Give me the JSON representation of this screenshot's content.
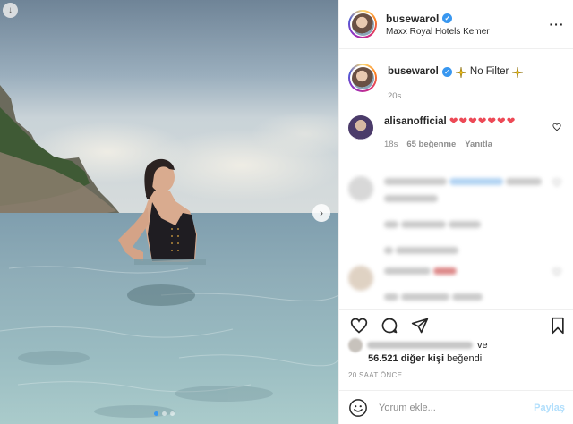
{
  "header": {
    "username": "busewarol",
    "location": "Maxx Royal Hotels Kemer",
    "more_icon": "more-horizontal-icon"
  },
  "caption": {
    "username": "busewarol",
    "text": "No Filter",
    "sparkle_icon": "sparkle-emoji-icon",
    "time": "20s"
  },
  "comments": [
    {
      "username": "alisanofficial",
      "text": "❤❤❤❤❤❤❤",
      "time": "18s",
      "likes": "65 beğenme",
      "reply": "Yanıtla"
    }
  ],
  "actions": {
    "like_icon": "heart-icon",
    "comment_icon": "comment-icon",
    "share_icon": "paper-plane-icon",
    "save_icon": "bookmark-icon"
  },
  "likes": {
    "connector": "ve",
    "count_text": "56.521 diğer kişi",
    "suffix": "beğendi"
  },
  "timestamp": "20 SAAT ÖNCE",
  "add_comment": {
    "placeholder": "Yorum ekle...",
    "post_label": "Paylaş",
    "emoji_icon": "smiley-icon"
  },
  "carousel": {
    "total": 3,
    "active": 0
  },
  "colors": {
    "accent": "#3897f0",
    "heart": "#ed4956",
    "text": "#262626",
    "muted": "#8e8e8e",
    "post_disabled": "#b2dffc"
  }
}
